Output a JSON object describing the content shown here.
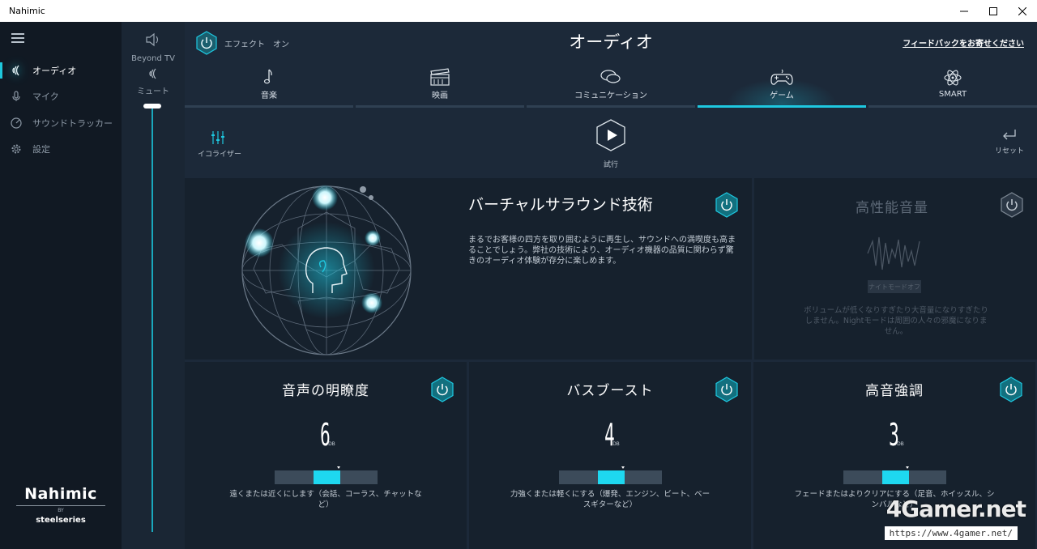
{
  "window": {
    "title": "Nahimic",
    "controls": [
      "minimize",
      "maximize",
      "close"
    ]
  },
  "sidebar": {
    "items": [
      {
        "label": "オーディオ",
        "icon": "audio-wave-icon",
        "active": true
      },
      {
        "label": "マイク",
        "icon": "microphone-icon",
        "active": false
      },
      {
        "label": "サウンドトラッカー",
        "icon": "radar-icon",
        "active": false
      },
      {
        "label": "設定",
        "icon": "gear-icon",
        "active": false
      }
    ],
    "logo": {
      "brand": "Nahimic",
      "by": "BY",
      "partner": "steelseries"
    }
  },
  "volume": {
    "device": "Beyond TV",
    "mute_label": "ミュート",
    "level": 1.0
  },
  "header": {
    "effect_label": "エフェクト　オン",
    "title": "オーディオ",
    "feedback": "フィードバックをお寄せください"
  },
  "tabs": [
    {
      "label": "音楽",
      "icon": "music-note-icon",
      "active": false
    },
    {
      "label": "映画",
      "icon": "clapperboard-icon",
      "active": false
    },
    {
      "label": "コミュニケーション",
      "icon": "chat-bubbles-icon",
      "active": false
    },
    {
      "label": "ゲーム",
      "icon": "gamepad-icon",
      "active": true
    },
    {
      "label": "SMART",
      "icon": "atom-icon",
      "active": false
    }
  ],
  "toolbar": {
    "equalizer": "イコライザー",
    "play": "試行",
    "reset": "リセット"
  },
  "surround": {
    "title": "バーチャルサラウンド技術",
    "description": "まるでお客様の四方を取り囲むように再生し、サウンドへの満喫度も高まることでしょう。弊社の技術により、オーディオ機器の品質に関わらず驚きのオーディオ体験が存分に楽しめます。",
    "enabled": true
  },
  "high_performance": {
    "title": "高性能音量",
    "badge": "ナイトモードオフ",
    "description": "ボリュームが低くなりすぎたり大音量になりすぎたりしません。Nightモードは周囲の人々の邪魔になりません。",
    "enabled": false
  },
  "cards": [
    {
      "title": "音声の明瞭度",
      "value": "6",
      "unit": "DB",
      "level": 0.5,
      "description": "遠くまたは近くにします（会話、コーラス、チャットなど）"
    },
    {
      "title": "バスブースト",
      "value": "4",
      "unit": "DB",
      "level": 0.5,
      "description": "力強くまたは軽くにする（爆発、エンジン、ビート、ベースギターなど）"
    },
    {
      "title": "高音強調",
      "value": "3",
      "unit": "DB",
      "level": 0.5,
      "description": "フェードまたはよりクリアにする（足音、ホイッスル、シンバルなど）"
    }
  ],
  "watermark": {
    "text": "4Gamer.net",
    "url": "https://www.4gamer.net/"
  },
  "colors": {
    "accent": "#1ec8e0",
    "background": "#1c2939",
    "panel": "#16212d",
    "sidebar": "#111923"
  }
}
